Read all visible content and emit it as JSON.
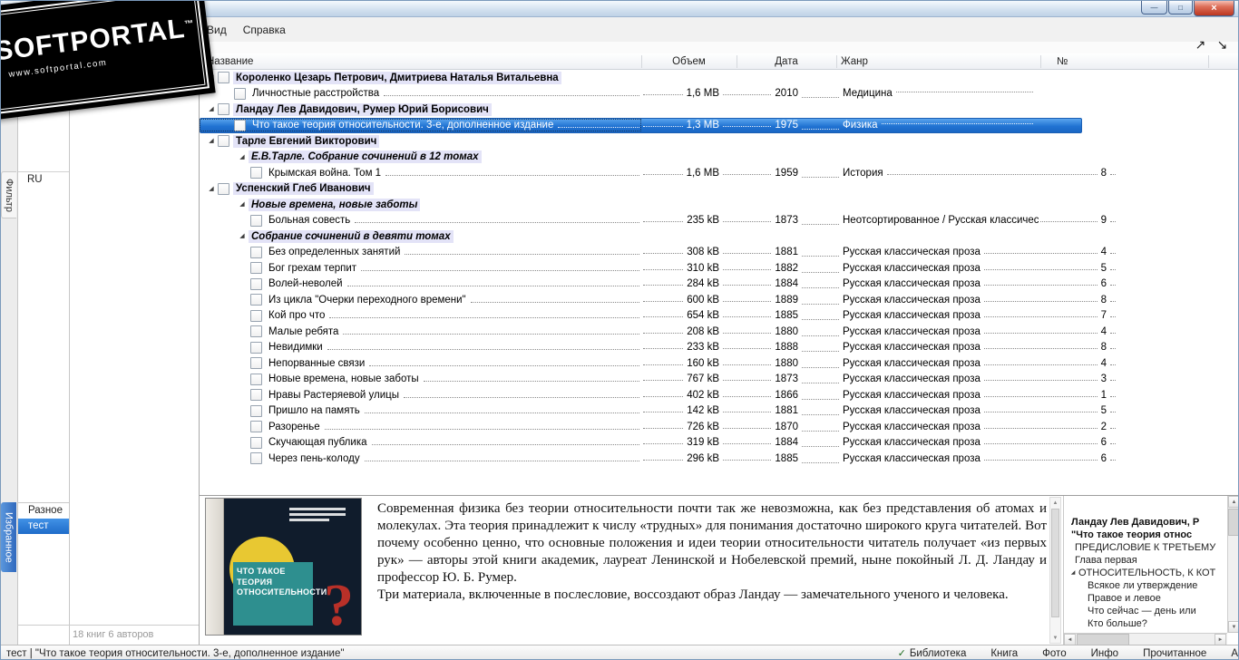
{
  "icons": {
    "minimize": "—",
    "maximize": "□",
    "close": "×",
    "collapse_all": "↗",
    "expand_all": "↘",
    "expander": "◢",
    "check": "✓",
    "arrow_up": "▲",
    "arrow_down": "▼",
    "arrow_left": "◄",
    "arrow_right": "►"
  },
  "logo": {
    "name": "SOFTPORTAL",
    "tm": "™",
    "url": "www.softportal.com"
  },
  "menu": {
    "items": [
      "Вид",
      "Справка"
    ]
  },
  "table": {
    "columns": {
      "title": "Название",
      "size": "Объем",
      "date": "Дата",
      "genre": "Жанр",
      "num": "№"
    },
    "rows": [
      {
        "t": "author",
        "title": "Короленко Цезарь Петрович, Дмитриева Наталья Витальевна"
      },
      {
        "t": "book",
        "lvl": 1,
        "title": "Личностные расстройства",
        "size": "1,6 MB",
        "year": "2010",
        "genre": "Медицина",
        "num": ""
      },
      {
        "t": "author",
        "title": "Ландау Лев Давидович, Румер Юрий Борисович"
      },
      {
        "t": "book",
        "lvl": 1,
        "title": "Что такое теория относительности. 3-е, дополненное издание",
        "size": "1,3 MB",
        "year": "1975",
        "genre": "Физика",
        "num": "",
        "sel": true
      },
      {
        "t": "author",
        "title": "Тарле Евгений Викторович"
      },
      {
        "t": "series",
        "title": "Е.В.Тарле. Собрание сочинений в 12 томах"
      },
      {
        "t": "book",
        "lvl": 2,
        "title": "Крымская война. Том 1",
        "size": "1,6 MB",
        "year": "1959",
        "genre": "История",
        "num": "8"
      },
      {
        "t": "author",
        "title": "Успенский Глеб Иванович"
      },
      {
        "t": "series",
        "title": "Новые времена, новые заботы"
      },
      {
        "t": "book",
        "lvl": 2,
        "title": "Больная совесть",
        "size": "235 kB",
        "year": "1873",
        "genre": "Неотсортированное / Русская классичес",
        "num": "9"
      },
      {
        "t": "series",
        "title": "Собрание сочинений в девяти томах"
      },
      {
        "t": "book",
        "lvl": 2,
        "title": "Без определенных занятий",
        "size": "308 kB",
        "year": "1881",
        "genre": "Русская классическая проза",
        "num": "4"
      },
      {
        "t": "book",
        "lvl": 2,
        "title": "Бог грехам терпит",
        "size": "310 kB",
        "year": "1882",
        "genre": "Русская классическая проза",
        "num": "5"
      },
      {
        "t": "book",
        "lvl": 2,
        "title": "Волей-неволей",
        "size": "284 kB",
        "year": "1884",
        "genre": "Русская классическая проза",
        "num": "6"
      },
      {
        "t": "book",
        "lvl": 2,
        "title": "Из цикла \"Очерки переходного времени\"",
        "size": "600 kB",
        "year": "1889",
        "genre": "Русская классическая проза",
        "num": "8"
      },
      {
        "t": "book",
        "lvl": 2,
        "title": "Кой про что",
        "size": "654 kB",
        "year": "1885",
        "genre": "Русская классическая проза",
        "num": "7"
      },
      {
        "t": "book",
        "lvl": 2,
        "title": "Малые ребята",
        "size": "208 kB",
        "year": "1880",
        "genre": "Русская классическая проза",
        "num": "4"
      },
      {
        "t": "book",
        "lvl": 2,
        "title": "Невидимки",
        "size": "233 kB",
        "year": "1888",
        "genre": "Русская классическая проза",
        "num": "8"
      },
      {
        "t": "book",
        "lvl": 2,
        "title": "Непорванные связи",
        "size": "160 kB",
        "year": "1880",
        "genre": "Русская классическая проза",
        "num": "4"
      },
      {
        "t": "book",
        "lvl": 2,
        "title": "Новые времена, новые заботы",
        "size": "767 kB",
        "year": "1873",
        "genre": "Русская классическая проза",
        "num": "3"
      },
      {
        "t": "book",
        "lvl": 2,
        "title": "Нравы Растеряевой улицы",
        "size": "402 kB",
        "year": "1866",
        "genre": "Русская классическая проза",
        "num": "1"
      },
      {
        "t": "book",
        "lvl": 2,
        "title": "Пришло на память",
        "size": "142 kB",
        "year": "1881",
        "genre": "Русская классическая проза",
        "num": "5"
      },
      {
        "t": "book",
        "lvl": 2,
        "title": "Разоренье",
        "size": "726 kB",
        "year": "1870",
        "genre": "Русская классическая проза",
        "num": "2"
      },
      {
        "t": "book",
        "lvl": 2,
        "title": "Скучающая публика",
        "size": "319 kB",
        "year": "1884",
        "genre": "Русская классическая проза",
        "num": "6"
      },
      {
        "t": "book",
        "lvl": 2,
        "title": "Через пень-колоду",
        "size": "296 kB",
        "year": "1885",
        "genre": "Русская классическая проза",
        "num": "6"
      }
    ]
  },
  "sidebar": {
    "tabs": [
      {
        "label": "Фильтр"
      },
      {
        "label": "Избранное",
        "active": true
      }
    ],
    "language": "RU",
    "groups": [
      {
        "label": "Разное"
      },
      {
        "label": "тест",
        "selected": true
      }
    ],
    "stats": "18 книг 6 авторов"
  },
  "preview": {
    "cover": {
      "title": "ЧТО ТАКОЕ ТЕОРИЯ ОТНОСИТЕЛЬНОСТИ",
      "mark": "?"
    },
    "annotation": {
      "paragraphs": [
        "Современная физика без теории относительности почти так же невозможна, как без представления об атомах и молекулах. Эта теория принадлежит к числу «трудных» для понимания достаточно широкого круга читателей. Вот почему особенно ценно, что основные положения и идеи теории относительности читатель получает «из первых рук» — авторы этой книги академик, лауреат Ленинской и Нобелевской премий, ныне покойный Л. Д. Ландау и профессор Ю. Б. Румер.",
        "Три материала, включенные в послесловие, воссоздают образ Ландау — замечательного ученого и человека."
      ]
    },
    "toc": {
      "items": [
        {
          "label": "Ландау Лев Давидович, Р",
          "b": true,
          "ind": 8
        },
        {
          "label": "\"Что такое теория относ",
          "b": true,
          "ind": 8
        },
        {
          "label": "ПРЕДИСЛОВИЕ К ТРЕТЬЕМУ",
          "ind": 12
        },
        {
          "label": "Глава первая",
          "ind": 12
        },
        {
          "label": "ОТНОСИТЕЛЬНОСТЬ, К КОТ",
          "ind": 4,
          "exp": true
        },
        {
          "label": "Всякое ли утверждение",
          "ind": 26
        },
        {
          "label": "Правое и левое",
          "ind": 26
        },
        {
          "label": "Что сейчас — день или",
          "ind": 26
        },
        {
          "label": "Кто больше?",
          "ind": 26
        }
      ]
    }
  },
  "statusbar": {
    "left": "тест | \"Что такое теория относительности. 3-е, дополненное издание\"",
    "right": [
      "Библиотека",
      "Книга",
      "Фото",
      "Инфо",
      "Прочитанное",
      "А"
    ],
    "checked_item": "Библиотека"
  },
  "colors": {
    "selection": "#2173d2",
    "author_highlight": "#e3e3f7",
    "favorites_tab": "#3b79c8"
  }
}
